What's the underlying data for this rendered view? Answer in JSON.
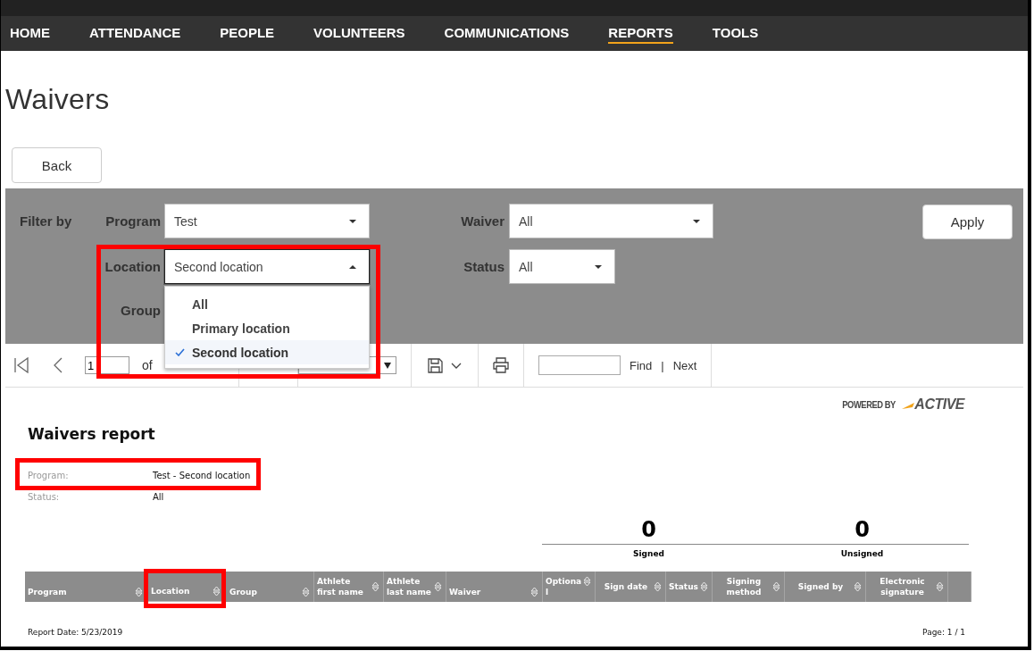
{
  "nav": [
    {
      "label": "HOME",
      "selected": false
    },
    {
      "label": "ATTENDANCE",
      "selected": false
    },
    {
      "label": "PEOPLE",
      "selected": false
    },
    {
      "label": "VOLUNTEERS",
      "selected": false
    },
    {
      "label": "COMMUNICATIONS",
      "selected": false
    },
    {
      "label": "REPORTS",
      "selected": true
    },
    {
      "label": "TOOLS",
      "selected": false
    }
  ],
  "page_title": "Waivers",
  "back_button": "Back",
  "filters": {
    "label": "Filter by",
    "apply_button": "Apply",
    "rows": [
      [
        {
          "label": "Program",
          "value": "Test",
          "open": false
        },
        {
          "label": "Waiver",
          "value": "All",
          "open": false
        }
      ],
      [
        {
          "label": "Location",
          "value": "Second location",
          "open": true,
          "options": [
            {
              "label": "All",
              "selected": false
            },
            {
              "label": "Primary location",
              "selected": false
            },
            {
              "label": "Second location",
              "selected": true
            }
          ]
        },
        {
          "label": "Status",
          "value": "All",
          "open": false
        }
      ],
      [
        {
          "label": "Group"
        }
      ]
    ]
  },
  "toolbar": {
    "page_value": "1",
    "of_label": "of",
    "find_button": "Find",
    "separator": "|",
    "next_button": "Next"
  },
  "report": {
    "powered_by": "POWERED BY",
    "brand": "ACTIVE",
    "title": "Waivers report",
    "info": [
      {
        "label": "Program:",
        "value": "Test - Second location"
      },
      {
        "label": "Status:",
        "value": "All"
      }
    ],
    "totals": [
      {
        "value": "0",
        "label": "Signed"
      },
      {
        "value": "0",
        "label": "Unsigned"
      }
    ],
    "columns": [
      "Program",
      "Location",
      "Group",
      "Athlete first name",
      "Athlete last name",
      "Waiver",
      "Optional",
      "Sign date",
      "Status",
      "Signing method",
      "Signed by",
      "Electronic signature"
    ],
    "report_date": "Report Date: 5/23/2019",
    "page_label": "Page:  1 / 1"
  }
}
